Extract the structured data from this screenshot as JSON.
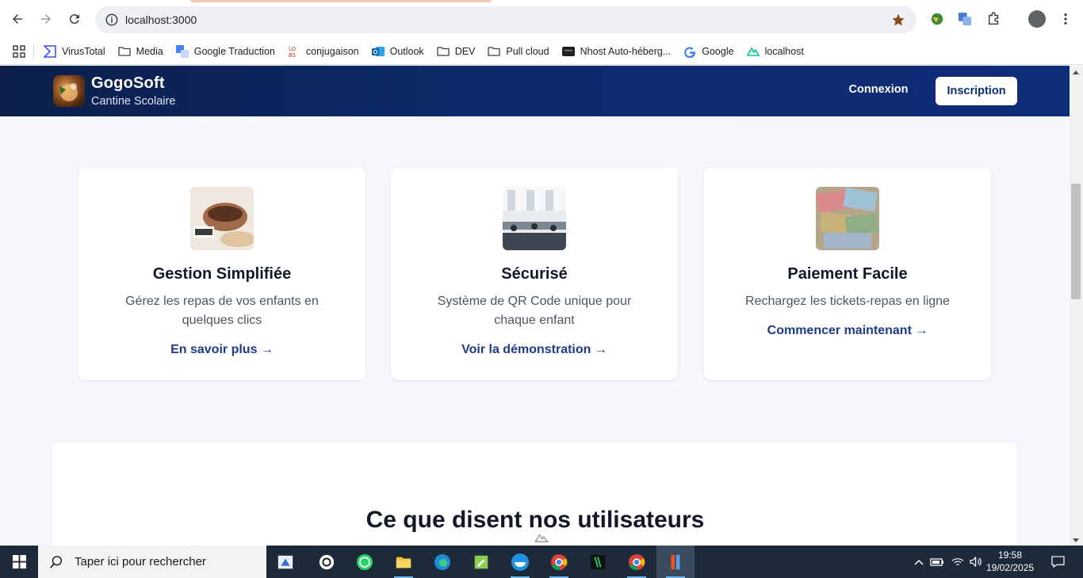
{
  "browser": {
    "url": "localhost:3000",
    "bookmarks": [
      {
        "label": "VirusTotal",
        "icon": "virustotal-icon"
      },
      {
        "label": "Media",
        "icon": "folder-icon"
      },
      {
        "label": "Google Traduction",
        "icon": "google-translate-icon"
      },
      {
        "label": "conjugaison",
        "icon": "conjugaison-icon"
      },
      {
        "label": "Outlook",
        "icon": "outlook-icon"
      },
      {
        "label": "DEV",
        "icon": "folder-icon"
      },
      {
        "label": "Pull cloud",
        "icon": "folder-icon"
      },
      {
        "label": "Nhost Auto-héberg...",
        "icon": "nhost-icon"
      },
      {
        "label": "Google",
        "icon": "google-icon"
      },
      {
        "label": "localhost",
        "icon": "nuxt-icon"
      }
    ]
  },
  "site": {
    "brand_name": "GogoSoft",
    "brand_sub": "Cantine Scolaire",
    "login_label": "Connexion",
    "signup_label": "Inscription",
    "features": [
      {
        "title": "Gestion Simplifiée",
        "desc": "Gérez les repas de vos enfants en quelques clics",
        "link": "En savoir plus →"
      },
      {
        "title": "Sécurisé",
        "desc": "Système de QR Code unique pour chaque enfant",
        "link": "Voir la démonstration →"
      },
      {
        "title": "Paiement Facile",
        "desc": "Rechargez les tickets-repas en ligne",
        "link": "Commencer maintenant →"
      }
    ],
    "testimonials_heading": "Ce que disent nos utilisateurs"
  },
  "taskbar": {
    "search_placeholder": "Taper ici pour rechercher",
    "time": "19:58",
    "date": "19/02/2025"
  },
  "colors": {
    "header_dark": "#0b1f4a",
    "header_blue": "#0e2d78",
    "link_blue": "#1e3a8a"
  }
}
